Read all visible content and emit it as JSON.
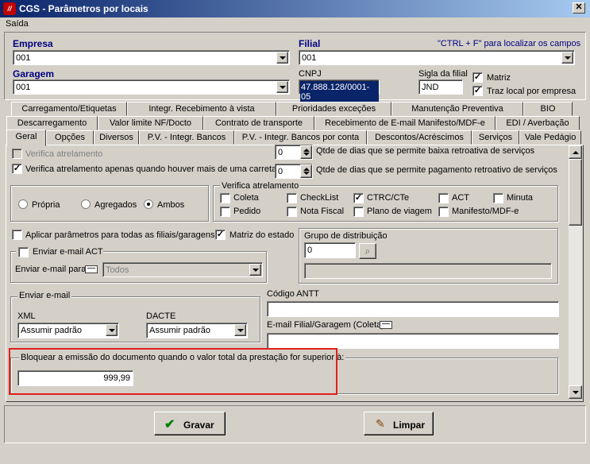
{
  "window": {
    "title": "CGS - Parâmetros por locais",
    "close": "✕"
  },
  "menu": {
    "saida": "Saída"
  },
  "header": {
    "empresa_label": "Empresa",
    "empresa_value": "001",
    "filial_label": "Filial",
    "filial_value": "001",
    "hint": "\"CTRL + F\" para localizar os campos",
    "garagem_label": "Garagem",
    "garagem_value": "001",
    "cnpj_label": "CNPJ",
    "cnpj_value": "47.888.128/0001-05",
    "sigla_label": "Sigla da filial",
    "sigla_value": "JND",
    "matriz_label": "Matriz",
    "traz_local_label": "Traz local por empresa"
  },
  "tabs": {
    "row1": [
      "Carregamento/Etiquetas",
      "Integr. Recebimento à vista",
      "Prioridades exceções",
      "Manutenção Preventiva",
      "BIO"
    ],
    "row2": [
      "Descarregamento",
      "Valor limite NF/Docto",
      "Contrato de transporte",
      "Recebimento de E-mail Manifesto/MDF-e",
      "EDI / Averbação"
    ],
    "row3": [
      "Geral",
      "Opções",
      "Diversos",
      "P.V. - Integr. Bancos",
      "P.V. - Integr. Bancos por conta",
      "Descontos/Acréscimos",
      "Serviços",
      "Vale Pedágio"
    ]
  },
  "geral": {
    "verifica_atrelamento": "Verifica atrelamento",
    "verifica_carreta": "Verifica atrelamento apenas quando houver mais de uma carreta",
    "dias_baixa_value": "0",
    "dias_baixa_label": "Qtde de dias que se permite baixa retroativa de serviços",
    "dias_pagto_value": "0",
    "dias_pagto_label": "Qtde de dias que se permite pagamento retroativo de serviços",
    "radio_propria": "Própria",
    "radio_agregados": "Agregados",
    "radio_ambos": "Ambos",
    "va_group_title": "Verifica atrelamento",
    "va_coleta": "Coleta",
    "va_checklist": "CheckList",
    "va_ctrc": "CTRC/CTe",
    "va_act": "ACT",
    "va_minuta": "Minuta",
    "va_pedido": "Pedido",
    "va_nota": "Nota Fiscal",
    "va_plano": "Plano de viagem",
    "va_manifesto": "Manifesto/MDF-e",
    "aplicar_label": "Aplicar parâmetros para todas as filiais/garagens",
    "matriz_estado_label": "Matriz do estado",
    "grupo_dist_label": "Grupo de distribuição",
    "grupo_dist_value": "0",
    "enviar_act_label": "Enviar e-mail ACT",
    "enviar_para_label": "Enviar e-mail para",
    "enviar_para_value": "Todos",
    "enviar_email_title": "Enviar e-mail",
    "xml_label": "XML",
    "xml_value": "Assumir padrão",
    "dacte_label": "DACTE",
    "dacte_value": "Assumir padrão",
    "codigo_antt_label": "Código ANTT",
    "email_filial_label": "E-mail Filial/Garagem (Coleta)",
    "bloquear_label": "Bloquear a emissão do documento quando o valor total da prestação for superior à:",
    "bloquear_value": "999,99"
  },
  "buttons": {
    "gravar": "Gravar",
    "limpar": "Limpar"
  },
  "colors": {
    "highlight_border": "#e0201c",
    "title_bar": "#0a246a",
    "cnpj_bg": "#0a246a"
  }
}
